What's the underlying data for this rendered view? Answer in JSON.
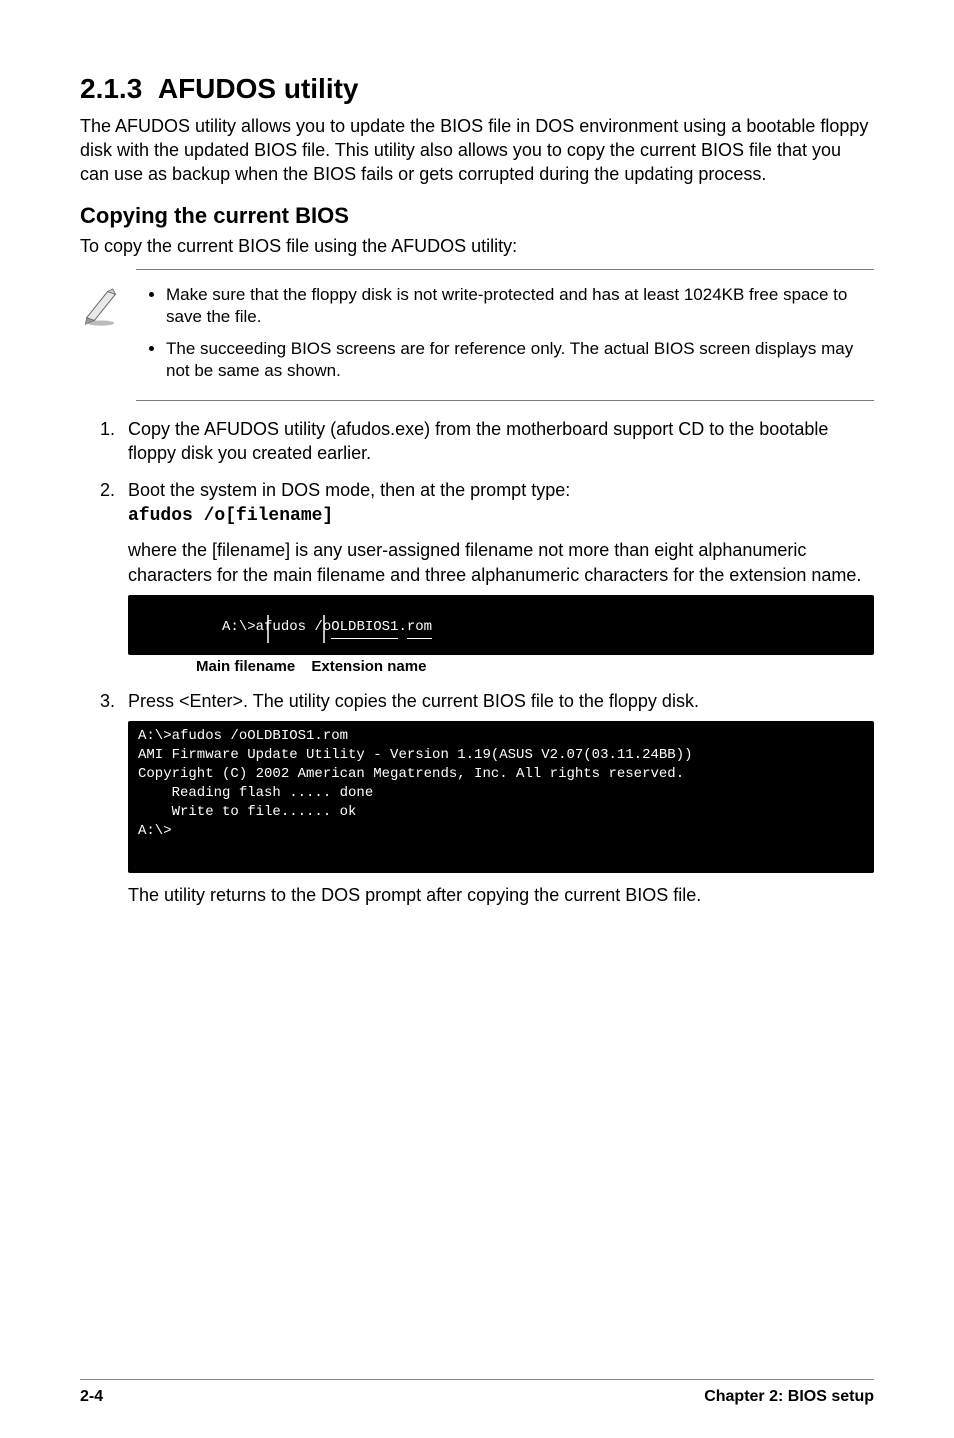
{
  "section": {
    "number": "2.1.3",
    "title": "AFUDOS utility",
    "intro": "The AFUDOS utility allows you to update the BIOS file in DOS environment using a bootable floppy disk with the updated BIOS file. This utility also allows you to copy the current BIOS file that you can use as backup when the BIOS fails or gets corrupted during the updating process."
  },
  "subsection": {
    "title": "Copying the current BIOS",
    "lead": "To copy the current BIOS file using the AFUDOS utility:"
  },
  "notes": [
    "Make sure that the floppy disk is not write-protected and has at least 1024KB free space to save the file.",
    "The succeeding BIOS screens are for reference only. The actual BIOS screen displays may not be same as shown."
  ],
  "steps": {
    "s1": "Copy the AFUDOS utility (afudos.exe) from the motherboard support CD to the bootable floppy disk you created earlier.",
    "s2a": "Boot the system in DOS mode, then at the prompt type:",
    "s2cmd": "afudos /o[filename]",
    "s2b": "where the [filename] is any user-assigned filename not more than eight alphanumeric characters  for the main filename and three alphanumeric characters for the extension name.",
    "s3": "Press <Enter>. The utility copies the current BIOS file to the floppy disk.",
    "after3": "The utility returns to the DOS prompt after copying the current BIOS file."
  },
  "term1": {
    "prefix": "A:\\>afudos /o",
    "main": "OLDBIOS1",
    "dot": ".",
    "ext": "rom"
  },
  "callouts": {
    "main": "Main filename",
    "ext": "Extension name"
  },
  "term2": "A:\\>afudos /oOLDBIOS1.rom\nAMI Firmware Update Utility - Version 1.19(ASUS V2.07(03.11.24BB))\nCopyright (C) 2002 American Megatrends, Inc. All rights reserved.\n    Reading flash ..... done\n    Write to file...... ok\nA:\\>",
  "footer": {
    "left": "2-4",
    "right": "Chapter 2: BIOS setup"
  }
}
